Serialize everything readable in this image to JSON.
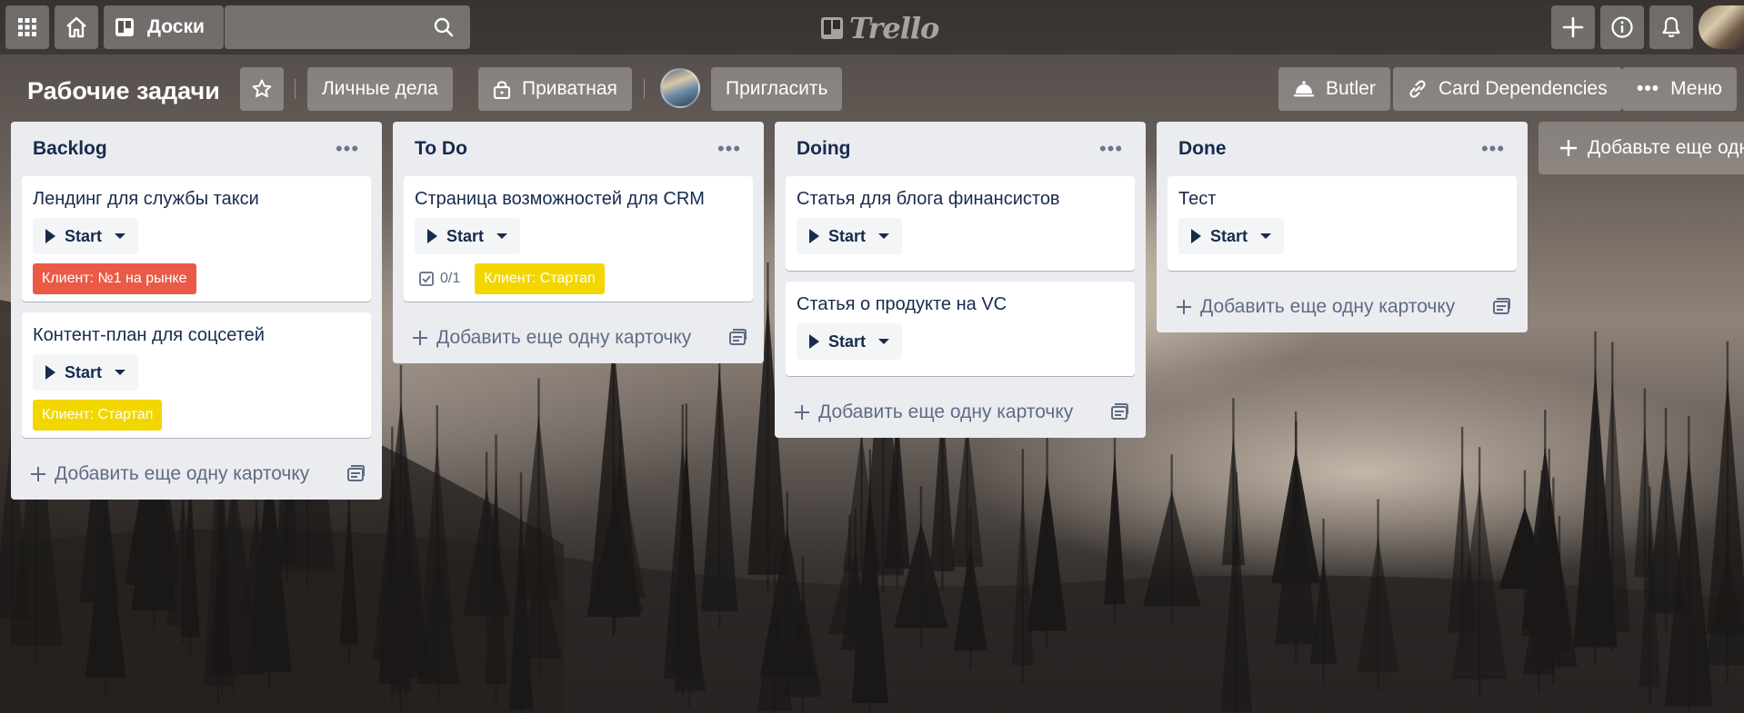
{
  "topnav": {
    "boards_label": "Доски",
    "search": {
      "value": "",
      "placeholder": ""
    },
    "logo_text": "Trello",
    "icons": [
      "apps-grid-icon",
      "home-icon",
      "boards-icon",
      "search-icon",
      "plus-icon",
      "info-icon",
      "bell-icon"
    ]
  },
  "board": {
    "title": "Рабочие задачи",
    "personal_label": "Личные дела",
    "privacy_label": "Приватная",
    "invite_label": "Пригласить",
    "butler_label": "Butler",
    "dependencies_label": "Card Dependencies",
    "menu_label": "Меню"
  },
  "lists": [
    {
      "title": "Backlog",
      "cards": [
        {
          "title": "Лендинг для службы такси",
          "start_label": "Start",
          "labels": [
            {
              "text": "Клиент: №1 на рынке",
              "color": "#eb5a46"
            }
          ]
        },
        {
          "title": "Контент-план для соцсетей",
          "start_label": "Start",
          "labels": [
            {
              "text": "Клиент: Стартап",
              "color": "#f2d600"
            }
          ]
        }
      ],
      "add_card_label": "Добавить еще одну карточку"
    },
    {
      "title": "To Do",
      "cards": [
        {
          "title": "Страница возможностей для CRM",
          "start_label": "Start",
          "checklist": "0/1",
          "labels": [
            {
              "text": "Клиент: Стартап",
              "color": "#f2d600"
            }
          ]
        }
      ],
      "add_card_label": "Добавить еще одну карточку"
    },
    {
      "title": "Doing",
      "cards": [
        {
          "title": "Статья для блога финансистов",
          "start_label": "Start"
        },
        {
          "title": "Статья о продукте на VC",
          "start_label": "Start"
        }
      ],
      "add_card_label": "Добавить еще одну карточку"
    },
    {
      "title": "Done",
      "cards": [
        {
          "title": "Тест",
          "start_label": "Start"
        }
      ],
      "add_card_label": "Добавить еще одну карточку"
    }
  ],
  "add_list_label": "Добавьте еще одн"
}
